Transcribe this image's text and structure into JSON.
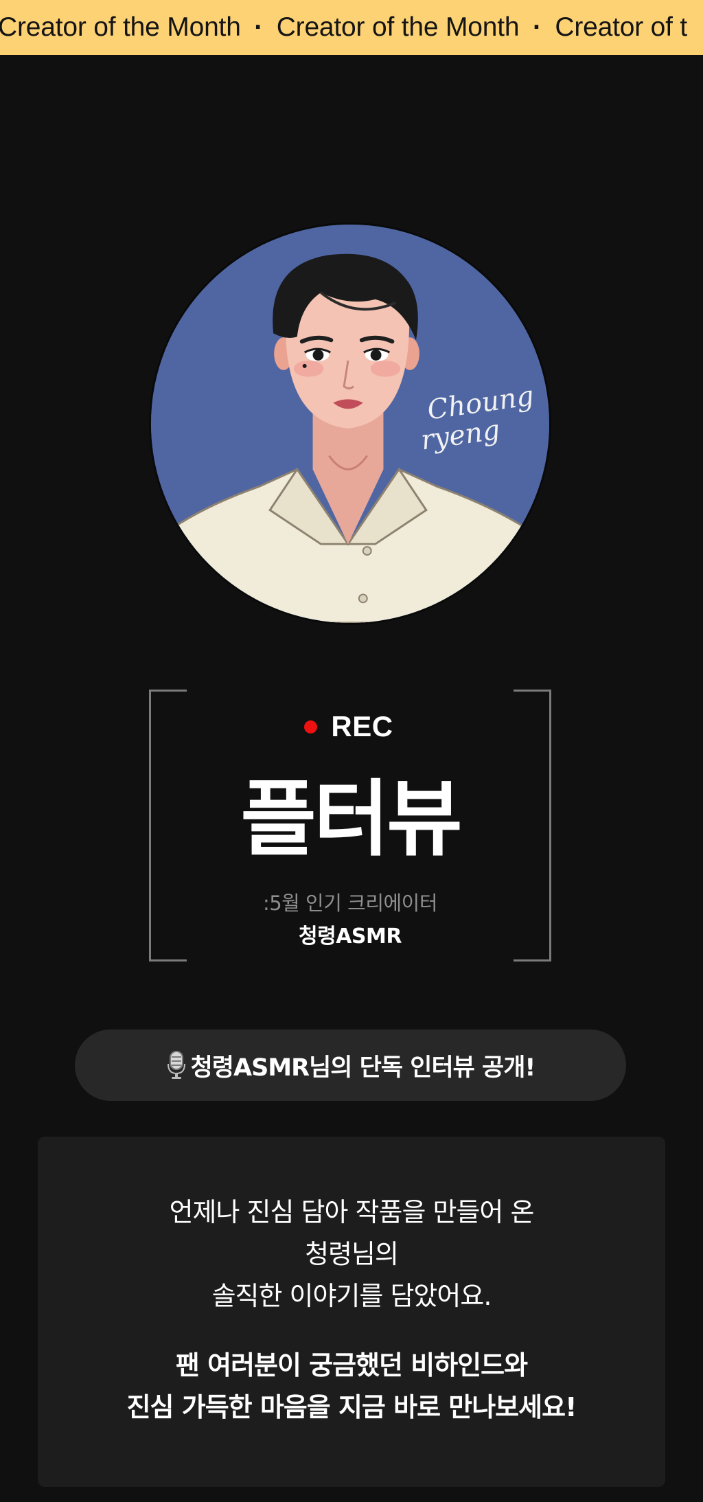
{
  "banner": {
    "items": [
      "Creator of the Month",
      "Creator of the Month",
      "Creator of t"
    ],
    "separator": "·"
  },
  "avatar": {
    "signature": "Choung ryeng",
    "background_color": "#4f66a3"
  },
  "rec": {
    "label": "REC",
    "dot_color": "#ee1111"
  },
  "headline": "플터뷰",
  "subline": ":5월 인기 크리에이터",
  "creator_name": "청령ASMR",
  "interview_button": {
    "icon": "microphone-icon",
    "label": "청령ASMR님의 단독 인터뷰 공개!"
  },
  "description": {
    "lines": [
      "언제나 진심 담아 작품을 만들어 온",
      "청령님의",
      "솔직한 이야기를 담았어요."
    ],
    "bold_lines": [
      "팬 여러분이 궁금했던 비하인드와",
      "진심 가득한 마음을 지금 바로 만나보세요!"
    ]
  },
  "colors": {
    "banner_bg": "#fdd275",
    "page_bg": "#101010",
    "pill_bg": "#282828",
    "card_bg": "#1d1d1d"
  }
}
